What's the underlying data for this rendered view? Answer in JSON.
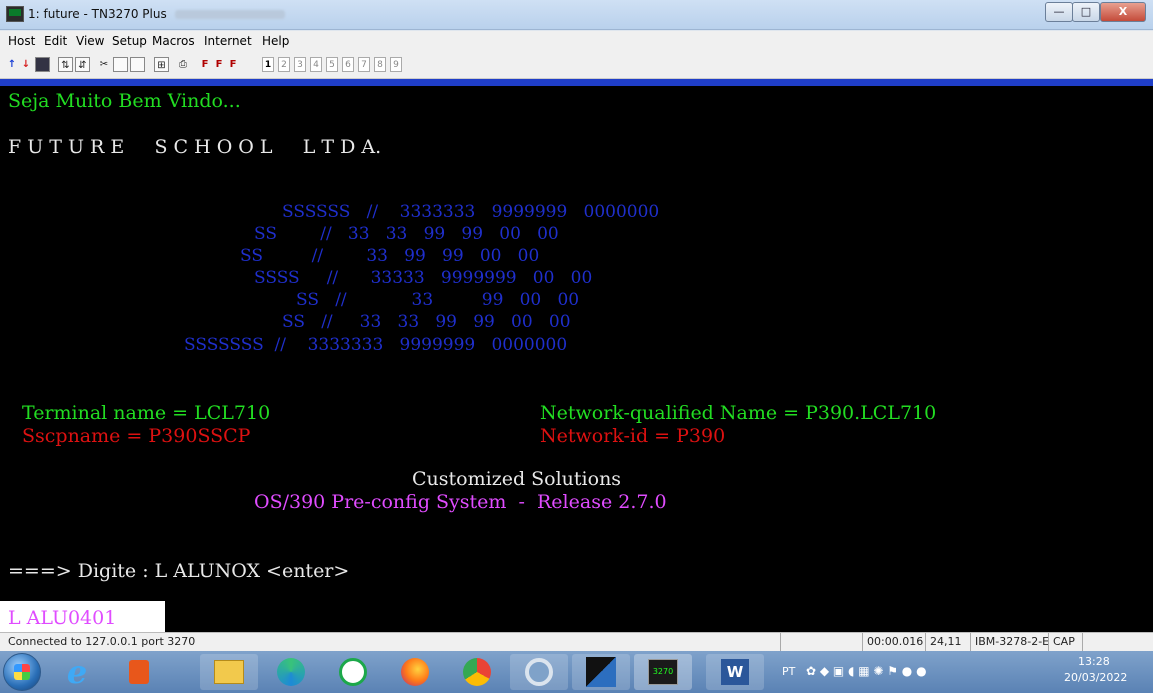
{
  "window": {
    "title": "1: future - TN3270 Plus",
    "controls": {
      "minimize": "—",
      "maximize": "□",
      "close": "X"
    }
  },
  "menu": {
    "items": [
      "Host",
      "Edit",
      "View",
      "Setup",
      "Macros",
      "Internet",
      "Help"
    ]
  },
  "toolbar": {
    "session_numbers": [
      "1",
      "2",
      "3",
      "4",
      "5",
      "6",
      "7",
      "8",
      "9"
    ],
    "font_buttons": [
      "F",
      "F",
      "F"
    ]
  },
  "terminal": {
    "welcome": "Seja Muito Bem Vindo...",
    "company": "F U T U R E     S C H O O L     L T D A.",
    "banner": [
      "SSSSSS   //    3333333   9999999   0000000",
      "SS        //   33   33   99   99   00   00",
      "SS         //        33   99   99   00   00",
      "SSSS     //      33333   9999999   00   00",
      "SS   //            33         99   00   00",
      "SS   //     33   33   99   99   00   00",
      "SSSSSSS  //    3333333   9999999   0000000"
    ],
    "terminal_name": "Terminal name = LCL710",
    "network_qualified_name": "Network-qualified Name = P390.LCL710",
    "sscp_name": "Sscpname = P390SSCP",
    "network_id": "Network-id = P390",
    "customized": "Customized Solutions",
    "release": "OS/390 Pre-config System  -  Release 2.7.0",
    "prompt": "===> Digite : L ALUNOX <enter>",
    "input_value": "L ALU0401",
    "colors": {
      "green": "#22dd22",
      "blue": "#1f2fcc",
      "red": "#dd1111",
      "magenta": "#e04cff",
      "white": "#e8e8e8"
    }
  },
  "status": {
    "connection": "Connected to 127.0.0.1 port 3270",
    "timer": "00:00.016",
    "cursor": "24,11",
    "model": "IBM-3278-2-E",
    "caps": "CAP"
  },
  "taskbar": {
    "apps": [
      "windows-start-icon",
      "internet-explorer-icon",
      "office-icon",
      "file-explorer-icon",
      "edge-icon",
      "malwarebytes-icon",
      "firefox-icon",
      "chrome-icon",
      "chrome-beta-icon",
      "puzzle-app-icon",
      "tn3270-icon",
      "word-icon"
    ],
    "tn3270_label": "3270",
    "word_label": "W",
    "language": "PT",
    "time": "13:28",
    "date": "20/03/2022"
  }
}
